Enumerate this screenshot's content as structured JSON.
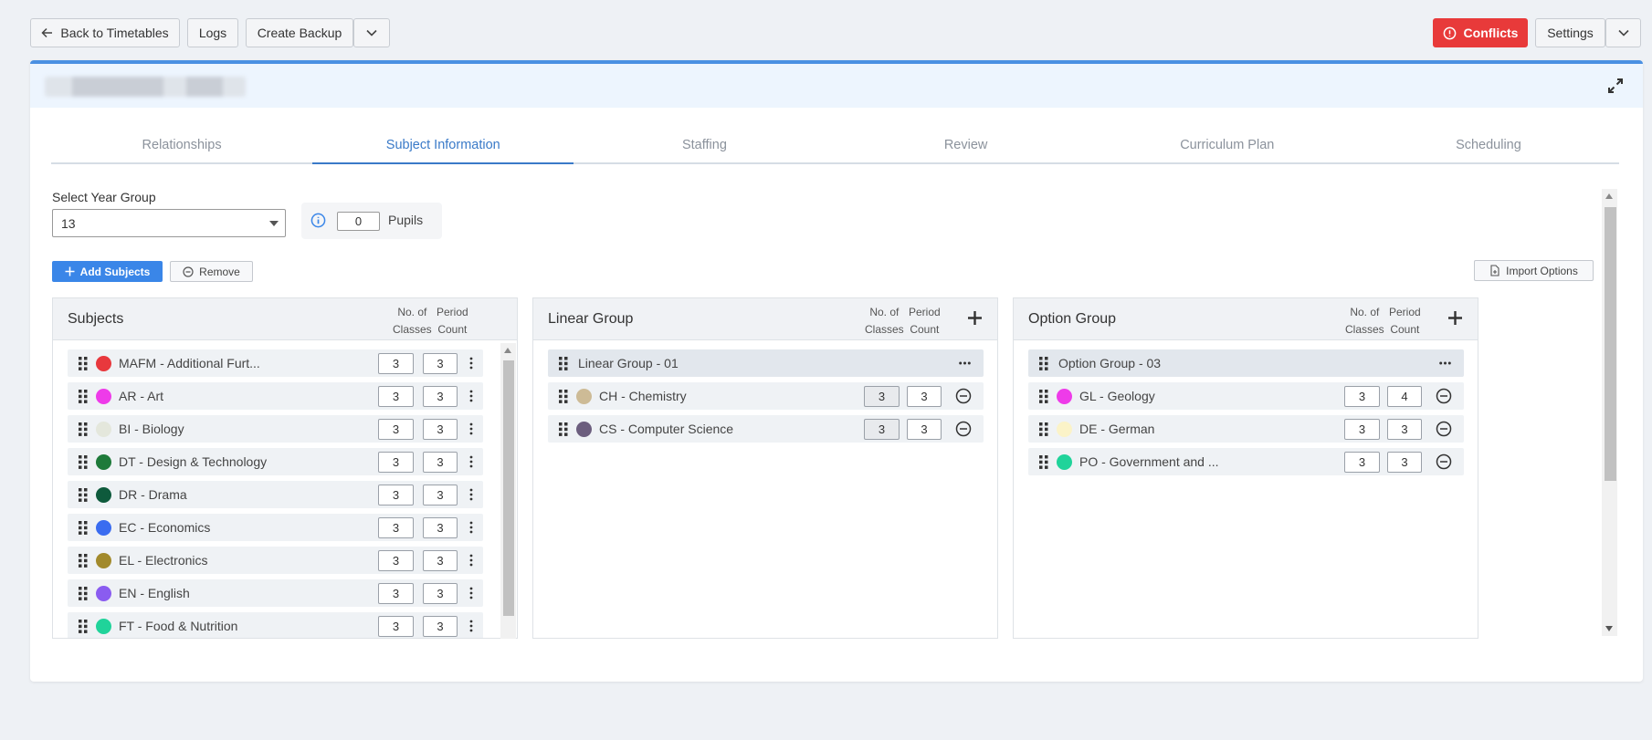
{
  "toolbar": {
    "back_label": "Back to Timetables",
    "logs_label": "Logs",
    "backup_label": "Create Backup",
    "conflicts_label": "Conflicts",
    "settings_label": "Settings"
  },
  "tabs": [
    {
      "label": "Relationships"
    },
    {
      "label": "Subject Information"
    },
    {
      "label": "Staffing"
    },
    {
      "label": "Review"
    },
    {
      "label": "Curriculum Plan"
    },
    {
      "label": "Scheduling"
    }
  ],
  "year_group": {
    "label": "Select Year Group",
    "value": "13",
    "pupils_value": "0",
    "pupils_label": "Pupils"
  },
  "actions": {
    "add_label": "Add Subjects",
    "remove_label": "Remove",
    "import_label": "Import Options"
  },
  "colors": {
    "accent": "#3a86e8",
    "danger": "#e83a3a"
  },
  "subjects": {
    "title": "Subjects",
    "col_classes": [
      "No. of",
      "Classes"
    ],
    "col_period": [
      "Period",
      "Count"
    ],
    "items": [
      {
        "label": "MAFM - Additional Furt...",
        "color": "#e8383d",
        "classes": "3",
        "periods": "3"
      },
      {
        "label": "AR - Art",
        "color": "#ee3be9",
        "classes": "3",
        "periods": "3"
      },
      {
        "label": "BI - Biology",
        "color": "#e4e7dc",
        "classes": "3",
        "periods": "3"
      },
      {
        "label": "DT - Design & Technology",
        "color": "#1e7a3a",
        "classes": "3",
        "periods": "3"
      },
      {
        "label": "DR - Drama",
        "color": "#0e5a3c",
        "classes": "3",
        "periods": "3"
      },
      {
        "label": "EC - Economics",
        "color": "#3a6cf0",
        "classes": "3",
        "periods": "3"
      },
      {
        "label": "EL - Electronics",
        "color": "#a28a2c",
        "classes": "3",
        "periods": "3"
      },
      {
        "label": "EN - English",
        "color": "#8a5cf0",
        "classes": "3",
        "periods": "3"
      },
      {
        "label": "FT - Food & Nutrition",
        "color": "#20d39a",
        "classes": "3",
        "periods": "3"
      }
    ]
  },
  "linear": {
    "title": "Linear Group",
    "col_classes": [
      "No. of",
      "Classes"
    ],
    "col_period": [
      "Period",
      "Count"
    ],
    "group_label": "Linear Group - 01",
    "items": [
      {
        "label": "CH - Chemistry",
        "color": "#cdbb96",
        "classes": "3",
        "periods": "3"
      },
      {
        "label": "CS - Computer Science",
        "color": "#6c5e7e",
        "classes": "3",
        "periods": "3"
      }
    ]
  },
  "option": {
    "title": "Option Group",
    "col_classes": [
      "No. of",
      "Classes"
    ],
    "col_period": [
      "Period",
      "Count"
    ],
    "group_label": "Option Group - 03",
    "items": [
      {
        "label": "GL - Geology",
        "color": "#ee3be9",
        "classes": "3",
        "periods": "4"
      },
      {
        "label": "DE - German",
        "color": "#fbf3c8",
        "classes": "3",
        "periods": "3"
      },
      {
        "label": "PO - Government and ...",
        "color": "#20d39a",
        "classes": "3",
        "periods": "3"
      }
    ]
  }
}
